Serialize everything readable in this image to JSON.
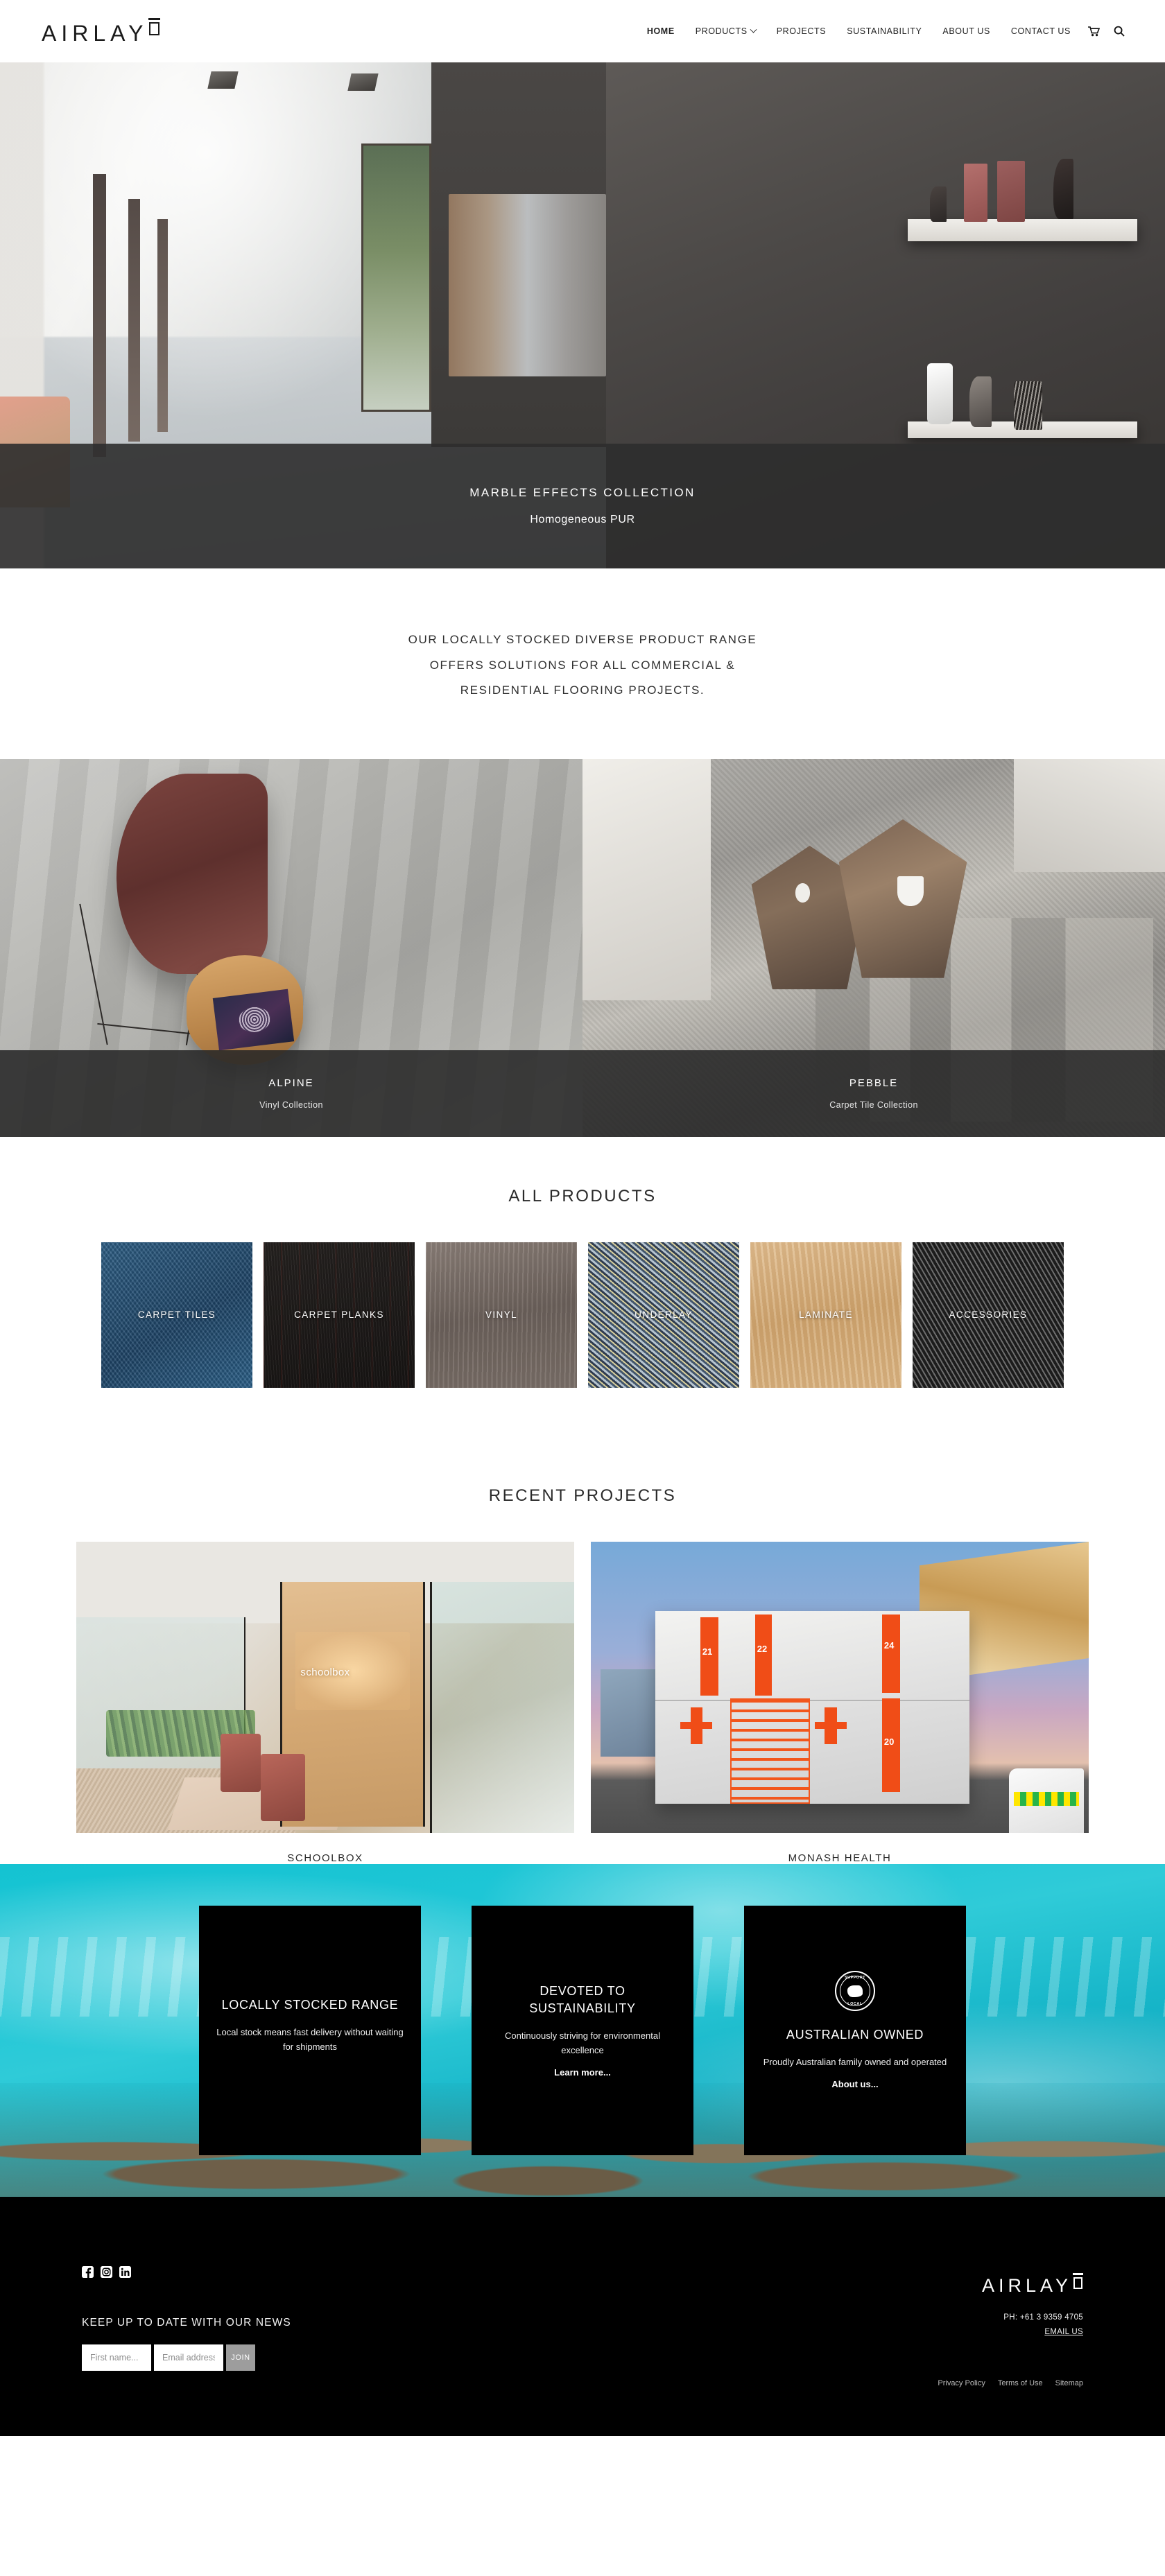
{
  "header": {
    "logo_text": "AIRLAY",
    "nav": [
      {
        "label": "HOME",
        "active": true,
        "caret": false
      },
      {
        "label": "PRODUCTS",
        "active": false,
        "caret": true
      },
      {
        "label": "PROJECTS",
        "active": false,
        "caret": false
      },
      {
        "label": "SUSTAINABILITY",
        "active": false,
        "caret": false
      },
      {
        "label": "ABOUT US",
        "active": false,
        "caret": false
      },
      {
        "label": "CONTACT US",
        "active": false,
        "caret": false
      }
    ],
    "cart_icon": "shopping-cart-icon",
    "search_icon": "search-icon"
  },
  "hero": {
    "title": "MARBLE EFFECTS COLLECTION",
    "subtitle": "Homogeneous PUR"
  },
  "intro": {
    "line1": "OUR LOCALLY STOCKED DIVERSE PRODUCT RANGE",
    "line2": "OFFERS SOLUTIONS FOR ALL COMMERCIAL &",
    "line3": "RESIDENTIAL FLOORING PROJECTS."
  },
  "collections": [
    {
      "title": "ALPINE",
      "subtitle": "Vinyl Collection"
    },
    {
      "title": "PEBBLE",
      "subtitle": "Carpet Tile Collection"
    }
  ],
  "all_products": {
    "heading": "ALL PRODUCTS",
    "items": [
      {
        "label": "CARPET TILES"
      },
      {
        "label": "CARPET PLANKS"
      },
      {
        "label": "VINYL"
      },
      {
        "label": "UNDERLAY"
      },
      {
        "label": "LAMINATE"
      },
      {
        "label": "ACCESSORIES"
      }
    ]
  },
  "recent_projects": {
    "heading": "RECENT PROJECTS",
    "items": [
      {
        "label": "SCHOOLBOX",
        "logo_text": "schoolbox"
      },
      {
        "label": "MONASH HEALTH",
        "unit_numbers": [
          "21",
          "22",
          "24",
          "20"
        ]
      }
    ]
  },
  "features": [
    {
      "title": "LOCALLY STOCKED RANGE",
      "body": "Local stock means fast delivery without waiting for shipments",
      "link": "",
      "badge": null
    },
    {
      "title": "DEVOTED TO SUSTAINABILITY",
      "body": "Continuously striving for environmental excellence",
      "link": "Learn more...",
      "badge": null
    },
    {
      "title": "AUSTRALIAN OWNED",
      "body": "Proudly Australian family owned and operated",
      "link": "About us...",
      "badge": {
        "icon": "support-local-badge-icon",
        "top": "SUPPORT",
        "bottom": "LOCAL"
      }
    }
  ],
  "footer": {
    "socials": [
      {
        "name": "facebook-icon",
        "glyph": "f"
      },
      {
        "name": "instagram-icon",
        "glyph": "▢"
      },
      {
        "name": "linkedin-icon",
        "glyph": "in"
      }
    ],
    "newsletter_title": "KEEP UP TO DATE WITH OUR NEWS",
    "first_name_placeholder": "First name...",
    "first_name_value": "",
    "email_placeholder": "Email address...",
    "email_value": "",
    "join_label": "JOIN",
    "logo_text": "AIRLAY",
    "phone": "PH: +61 3 9359 4705",
    "email_us": "EMAIL US",
    "legal": [
      {
        "label": "Privacy Policy"
      },
      {
        "label": "Terms of Use"
      },
      {
        "label": "Sitemap"
      }
    ]
  },
  "colors": {
    "accent_ocean": "#17bfd0",
    "dark": "#000000",
    "overlay": "rgba(45,45,45,0.9)",
    "join_button": "#9d9d9d"
  }
}
